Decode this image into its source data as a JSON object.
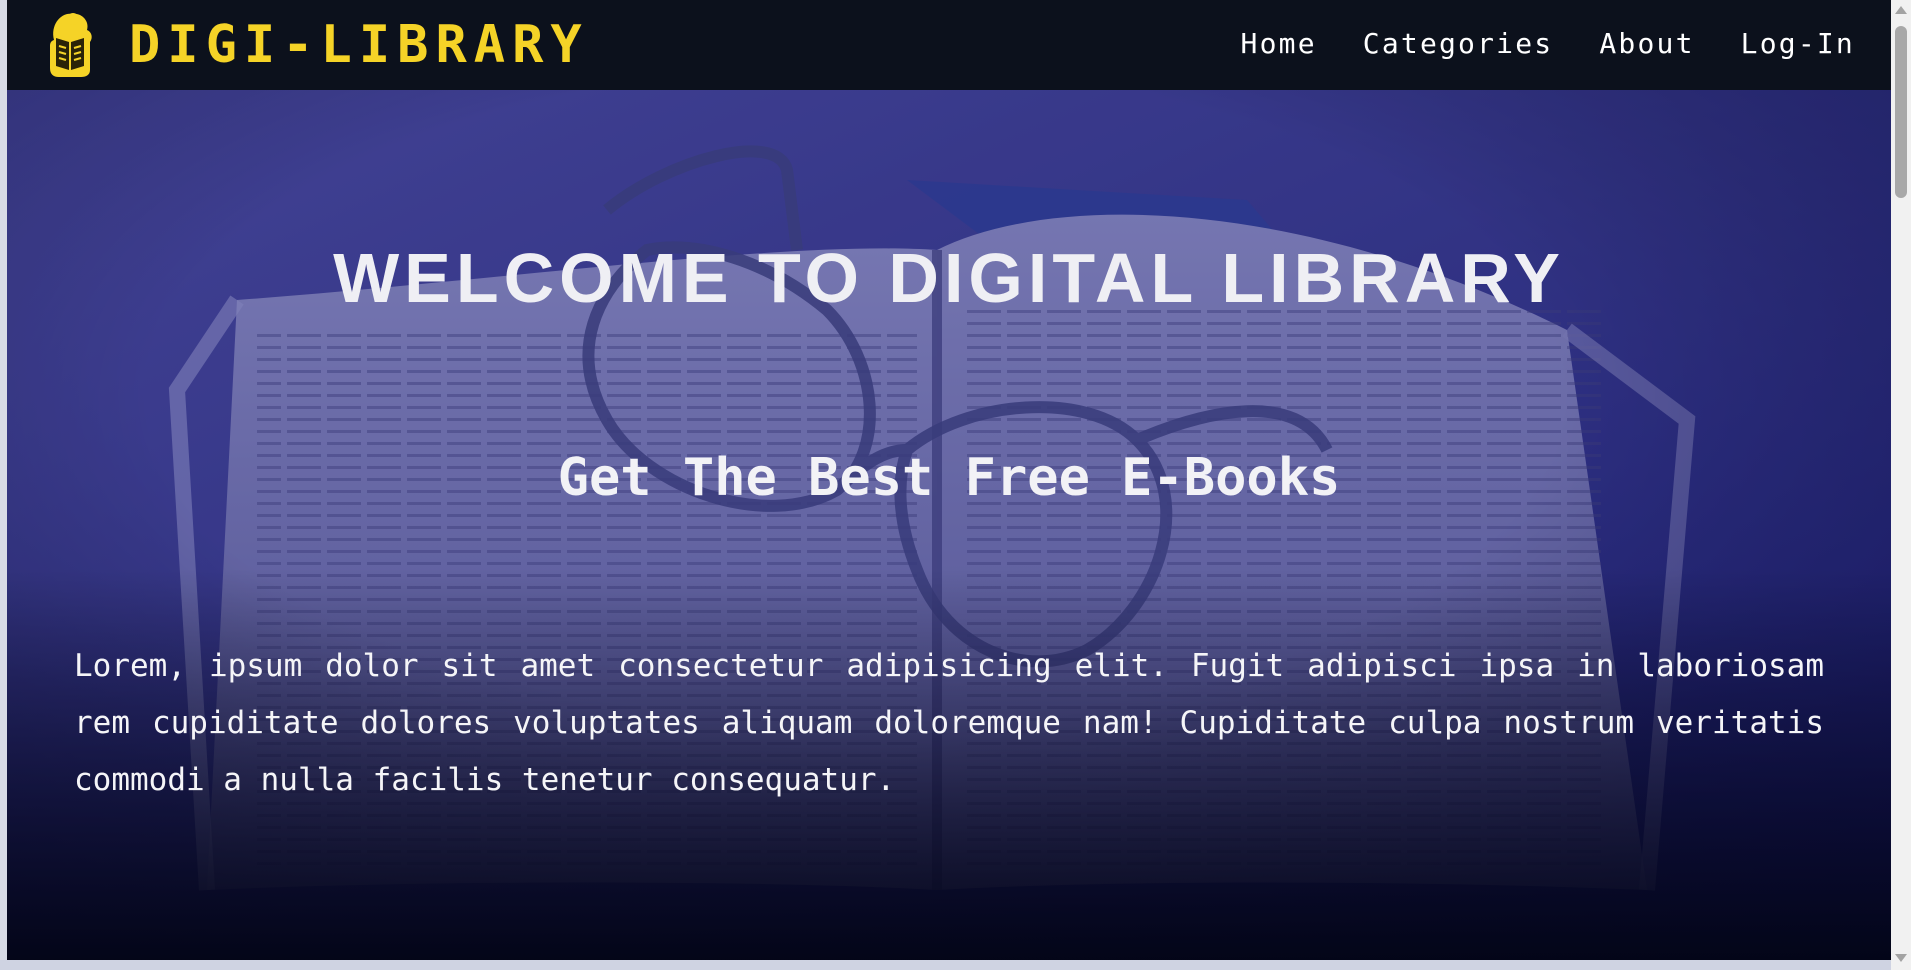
{
  "brand": {
    "name": "DIGI-LIBRARY",
    "color": "#f5d327"
  },
  "nav": {
    "items": [
      "Home",
      "Categories",
      "About",
      "Log-In"
    ]
  },
  "hero": {
    "title": "WELCOME TO DIGITAL LIBRARY",
    "subtitle": "Get The Best Free E-Books",
    "text": "Lorem, ipsum dolor sit amet consectetur adipisicing elit. Fugit adipisci ipsa in laboriosam rem cupiditate dolores voluptates aliquam doloremque nam! Cupiditate culpa nostrum veritatis commodi a nulla facilis tenetur consequatur.",
    "background_image": "open-book-with-eyeglasses",
    "overlay_color": "#1f2390"
  },
  "icons": {
    "logo": "reading-person-logo-icon"
  }
}
